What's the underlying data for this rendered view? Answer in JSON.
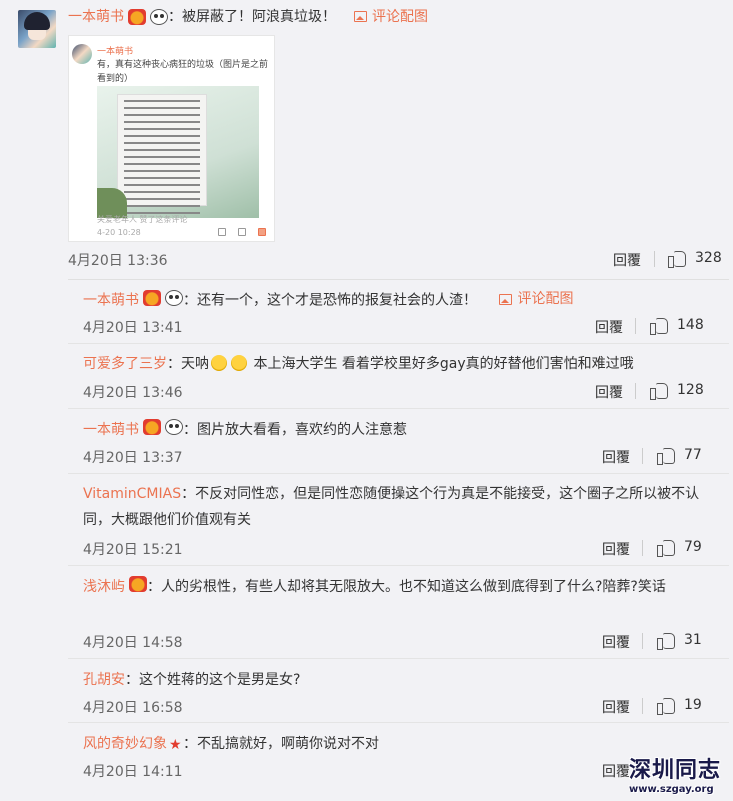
{
  "main_comment": {
    "username": "一本萌书",
    "text": "：被屏蔽了！阿浪真垃圾！",
    "pic_link": "评论配图",
    "date": "4月20日 13:36",
    "reply_label": "回覆",
    "likes": "328",
    "thumbnail": {
      "username": "一本萌书",
      "text": "有，真有这种丧心病狂的垃圾（图片是之前看到的）",
      "footer": "关爱老年人 赞了这条评论",
      "date": "4-20 10:28"
    }
  },
  "sub_comments": [
    {
      "username": "一本萌书",
      "text": "：还有一个，这个才是恐怖的报复社会的人渣！",
      "pic_link": "评论配图",
      "date": "4月20日 13:41",
      "reply_label": "回覆",
      "likes": "148"
    },
    {
      "username": "可爱多了三岁",
      "text_before": "：天呐",
      "text_after": "本上海大学生 看着学校里好多gay真的好替他们害怕和难过哦",
      "date": "4月20日 13:46",
      "reply_label": "回覆",
      "likes": "128"
    },
    {
      "username": "一本萌书",
      "text": "：图片放大看看，喜欢约的人注意惹",
      "date": "4月20日 13:37",
      "reply_label": "回覆",
      "likes": "77"
    },
    {
      "username": "VitaminCMIAS",
      "text": "：不反对同性恋，但是同性恋随便操这个行为真是不能接受，这个圈子之所以被不认同，大概跟他们价值观有关",
      "date": "4月20日 15:21",
      "reply_label": "回覆",
      "likes": "79"
    },
    {
      "username": "浅沐屿",
      "text": "：人的劣根性，有些人却将其无限放大。也不知道这么做到底得到了什么?陪葬?笑话",
      "date": "4月20日 14:58",
      "reply_label": "回覆",
      "likes": "31"
    },
    {
      "username": "孔胡安",
      "text": "：这个姓蒋的这个是男是女?",
      "date": "4月20日 16:58",
      "reply_label": "回覆",
      "likes": "19"
    },
    {
      "username": "风的奇妙幻象",
      "text": "：不乱搞就好，啊萌你说对不对",
      "date": "4月20日 14:11",
      "reply_label": "回覆"
    }
  ],
  "watermark": {
    "title": "深圳同志",
    "url": "www.szgay.org"
  }
}
